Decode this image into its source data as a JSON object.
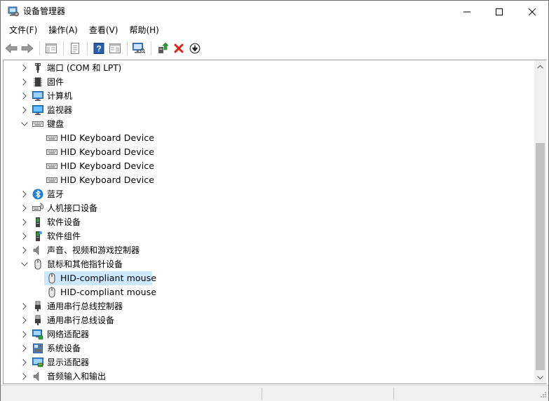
{
  "window": {
    "title": "设备管理器"
  },
  "menu": [
    {
      "label": "文件(F)"
    },
    {
      "label": "操作(A)"
    },
    {
      "label": "查看(V)"
    },
    {
      "label": "帮助(H)"
    }
  ],
  "toolbar": {
    "icons": [
      "back-icon",
      "forward-icon",
      "show-hide-tree-icon",
      "properties-icon",
      "help-icon",
      "view-icon",
      "scan-hardware-icon",
      "update-driver-icon",
      "uninstall-icon",
      "disable-icon"
    ]
  },
  "tree": {
    "items": [
      {
        "label": "端口 (COM 和 LPT)",
        "kind": "category",
        "expanded": false
      },
      {
        "label": "固件",
        "kind": "category",
        "expanded": false
      },
      {
        "label": "计算机",
        "kind": "category",
        "expanded": false
      },
      {
        "label": "监视器",
        "kind": "category",
        "expanded": false
      },
      {
        "label": "键盘",
        "kind": "category",
        "expanded": true
      },
      {
        "label": "HID Keyboard Device",
        "kind": "device"
      },
      {
        "label": "HID Keyboard Device",
        "kind": "device"
      },
      {
        "label": "HID Keyboard Device",
        "kind": "device"
      },
      {
        "label": "HID Keyboard Device",
        "kind": "device"
      },
      {
        "label": "蓝牙",
        "kind": "category",
        "expanded": false
      },
      {
        "label": "人机接口设备",
        "kind": "category",
        "expanded": false
      },
      {
        "label": "软件设备",
        "kind": "category",
        "expanded": false
      },
      {
        "label": "软件组件",
        "kind": "category",
        "expanded": false
      },
      {
        "label": "声音、视频和游戏控制器",
        "kind": "category",
        "expanded": false
      },
      {
        "label": "鼠标和其他指针设备",
        "kind": "category",
        "expanded": true
      },
      {
        "label": "HID-compliant mouse",
        "kind": "device",
        "selected": true
      },
      {
        "label": "HID-compliant mouse",
        "kind": "device"
      },
      {
        "label": "通用串行总线控制器",
        "kind": "category",
        "expanded": false
      },
      {
        "label": "通用串行总线设备",
        "kind": "category",
        "expanded": false
      },
      {
        "label": "网络适配器",
        "kind": "category",
        "expanded": false
      },
      {
        "label": "系统设备",
        "kind": "category",
        "expanded": false
      },
      {
        "label": "显示适配器",
        "kind": "category",
        "expanded": false
      },
      {
        "label": "音频输入和输出",
        "kind": "category",
        "expanded": false
      }
    ]
  },
  "colors": {
    "selection": "#cce8ff",
    "scrollbar_thumb": "#c1c1c1",
    "uninstall_red": "#d9261c",
    "update_green": "#2e9e3a",
    "help_blue": "#2a5db0"
  }
}
